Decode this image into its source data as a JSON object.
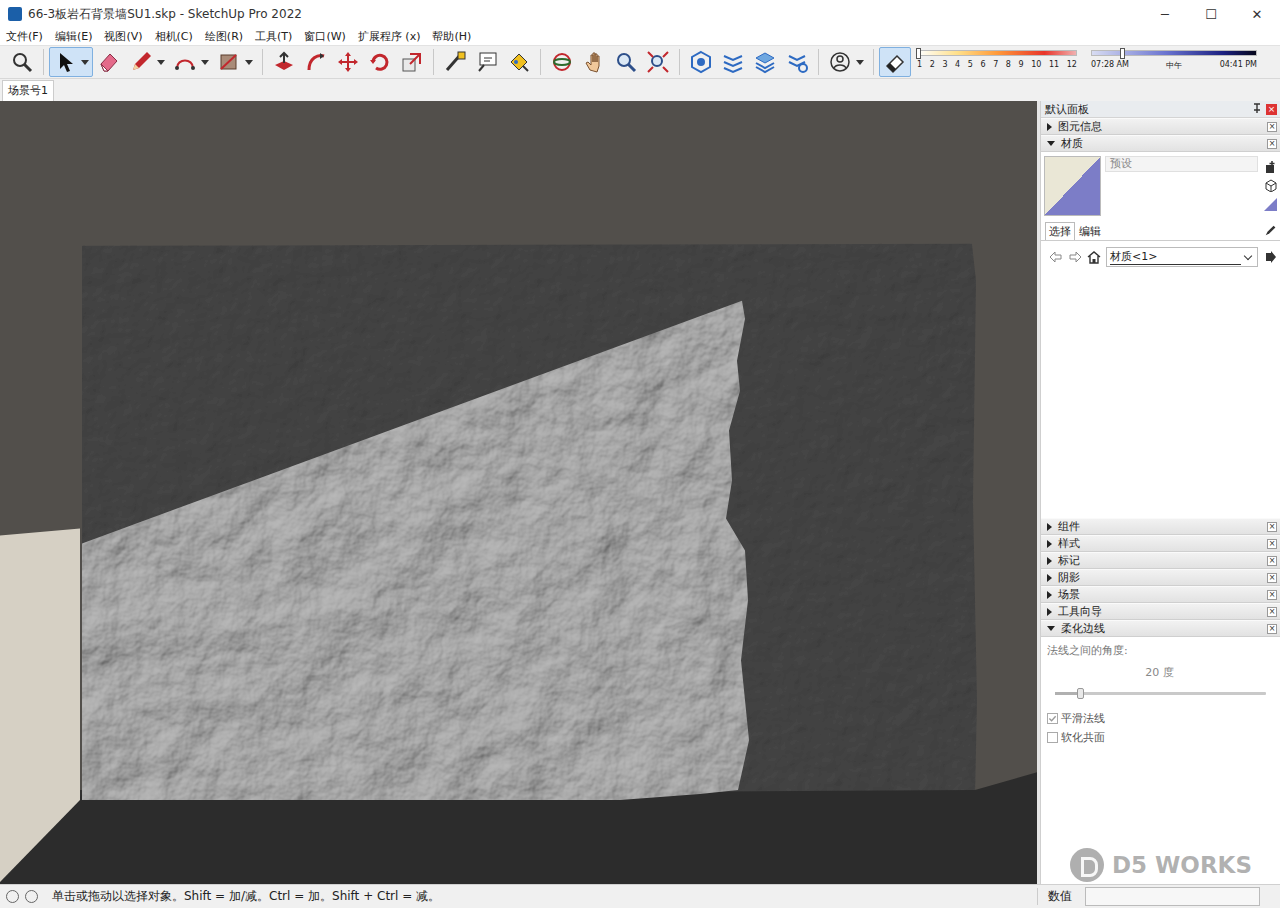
{
  "window": {
    "title": "66-3板岩石背景墙SU1.skp - SketchUp Pro 2022",
    "controls": [
      "─",
      "☐",
      "✕"
    ]
  },
  "menu": [
    "文件(F)",
    "编辑(E)",
    "视图(V)",
    "相机(C)",
    "绘图(R)",
    "工具(T)",
    "窗口(W)",
    "扩展程序 (x)",
    "帮助(H)"
  ],
  "tools": [
    {
      "kind": "button",
      "selected": false
    },
    {
      "kind": "split",
      "selected": true
    },
    {
      "kind": "button",
      "selected": false
    },
    {
      "kind": "split",
      "selected": false
    },
    {
      "kind": "split",
      "selected": false
    },
    {
      "kind": "split",
      "selected": false
    },
    {
      "kind": "button",
      "selected": false
    },
    {
      "kind": "button",
      "selected": false
    },
    {
      "kind": "button",
      "selected": false
    },
    {
      "kind": "button",
      "selected": false
    },
    {
      "kind": "button",
      "selected": false
    },
    {
      "kind": "button",
      "selected": false
    },
    {
      "kind": "button",
      "selected": false
    },
    {
      "kind": "button",
      "selected": false
    },
    {
      "kind": "button",
      "selected": false
    },
    {
      "kind": "button",
      "selected": false
    },
    {
      "kind": "button",
      "selected": false
    },
    {
      "kind": "button",
      "selected": false
    },
    {
      "kind": "button",
      "selected": false
    },
    {
      "kind": "button",
      "selected": false
    },
    {
      "kind": "button",
      "selected": false
    },
    {
      "kind": "button",
      "selected": false
    },
    {
      "kind": "split",
      "selected": false
    },
    {
      "kind": "button",
      "selected": true
    }
  ],
  "shadow": {
    "months": [
      "1",
      "2",
      "3",
      "4",
      "5",
      "6",
      "7",
      "8",
      "9",
      "10",
      "11",
      "12"
    ],
    "month_level": 0.0,
    "times": [
      "07:28 AM",
      "中午",
      "04:41 PM"
    ],
    "time_level": 0.18
  },
  "scene_tabs": [
    {
      "label": "场景号1",
      "selected": true
    }
  ],
  "panel": {
    "title": "默认面板",
    "close": "×",
    "sections_top": [
      {
        "label": "图元信息",
        "expanded": false
      },
      {
        "label": "材质",
        "expanded": true
      }
    ],
    "material": {
      "name": "预设",
      "tabs": [
        {
          "label": "选择",
          "selected": true
        },
        {
          "label": "编辑",
          "selected": false
        }
      ],
      "library": "材质<1>"
    },
    "sections_bottom": [
      {
        "label": "组件",
        "expanded": false
      },
      {
        "label": "样式",
        "expanded": false
      },
      {
        "label": "标记",
        "expanded": false
      },
      {
        "label": "阴影",
        "expanded": false
      },
      {
        "label": "场景",
        "expanded": false
      },
      {
        "label": "工具向导",
        "expanded": false
      },
      {
        "label": "柔化边线",
        "expanded": true
      }
    ],
    "soften": {
      "label": "法线之间的角度:",
      "value": "20 度",
      "level": 0.12,
      "checks": [
        {
          "label": "平滑法线",
          "checked": true,
          "disabled": true
        },
        {
          "label": "软化共面",
          "checked": false,
          "disabled": true
        }
      ]
    }
  },
  "watermark": "D5 WORKS",
  "status_bar": {
    "message": "单击或拖动以选择对象。Shift = 加/减。Ctrl = 加。Shift + Ctrl = 减。",
    "value_label": "数值",
    "value": ""
  }
}
